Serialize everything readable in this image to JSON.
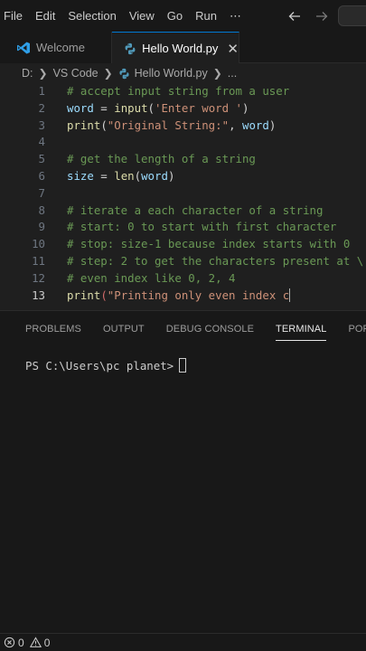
{
  "menu": {
    "items": [
      "File",
      "Edit",
      "Selection",
      "View",
      "Go",
      "Run",
      "⋯"
    ]
  },
  "tabs": [
    {
      "label": "Welcome",
      "icon": "vscode-logo-icon",
      "active": false
    },
    {
      "label": "Hello World.py",
      "icon": "python-file-icon",
      "active": true,
      "close": "✕"
    }
  ],
  "breadcrumb": {
    "drive": "D:",
    "folder": "VS Code",
    "file": "Hello World.py",
    "more": "..."
  },
  "editor": {
    "current_line": 13,
    "lines": [
      {
        "n": "1",
        "tokens": [
          [
            "cm",
            "# accept input string from a user"
          ]
        ]
      },
      {
        "n": "2",
        "tokens": [
          [
            "vr",
            "word"
          ],
          [
            "pn",
            " = "
          ],
          [
            "fn",
            "input"
          ],
          [
            "pn",
            "("
          ],
          [
            "st",
            "'Enter word '"
          ],
          [
            "pn",
            ")"
          ]
        ]
      },
      {
        "n": "3",
        "tokens": [
          [
            "fn",
            "print"
          ],
          [
            "pn",
            "("
          ],
          [
            "st",
            "\"Original String:\""
          ],
          [
            "pn",
            ", "
          ],
          [
            "vr",
            "word"
          ],
          [
            "pn",
            ")"
          ]
        ]
      },
      {
        "n": "4",
        "tokens": []
      },
      {
        "n": "5",
        "tokens": [
          [
            "cm",
            "# get the length of a string"
          ]
        ]
      },
      {
        "n": "6",
        "tokens": [
          [
            "vr",
            "size"
          ],
          [
            "pn",
            " = "
          ],
          [
            "fn",
            "len"
          ],
          [
            "pn",
            "("
          ],
          [
            "vr",
            "word"
          ],
          [
            "pn",
            ")"
          ]
        ]
      },
      {
        "n": "7",
        "tokens": []
      },
      {
        "n": "8",
        "tokens": [
          [
            "cm",
            "# iterate a each character of a string"
          ]
        ]
      },
      {
        "n": "9",
        "tokens": [
          [
            "cm",
            "# start: 0 to start with first character"
          ]
        ]
      },
      {
        "n": "10",
        "tokens": [
          [
            "cm",
            "# stop: size-1 because index starts with 0"
          ]
        ]
      },
      {
        "n": "11",
        "tokens": [
          [
            "cm",
            "# step: 2 to get the characters present at \\"
          ]
        ]
      },
      {
        "n": "12",
        "tokens": [
          [
            "cm",
            "# even index like 0, 2, 4"
          ]
        ]
      },
      {
        "n": "13",
        "tokens": [
          [
            "fn",
            "print"
          ],
          [
            "pbad",
            "("
          ],
          [
            "st",
            "\"Printing only even index c"
          ]
        ]
      }
    ]
  },
  "panel": {
    "tabs": [
      "PROBLEMS",
      "OUTPUT",
      "DEBUG CONSOLE",
      "TERMINAL",
      "PORTS"
    ],
    "active_tab": "TERMINAL",
    "prompt": "PS C:\\Users\\pc planet>"
  },
  "status": {
    "errors": "0",
    "warnings": "0"
  },
  "colors": {
    "accent": "#0078d4",
    "python_icon": "#519aba",
    "vscode_logo": "#2f9fe8"
  }
}
